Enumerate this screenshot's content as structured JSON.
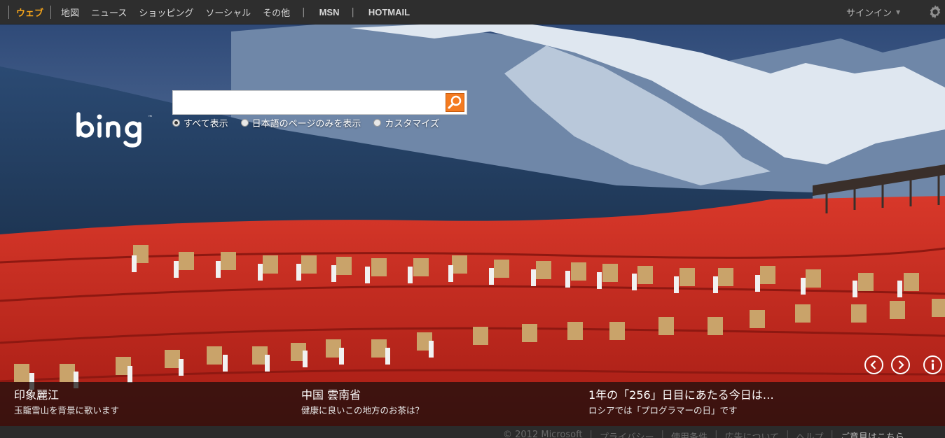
{
  "nav": {
    "web": "ウェブ",
    "maps": "地図",
    "news": "ニュース",
    "shopping": "ショッピング",
    "social": "ソーシャル",
    "more": "その他",
    "separator": "|",
    "msn": "MSN",
    "hotmail": "HOTMAIL"
  },
  "header": {
    "signin": "サインイン",
    "signin_caret": "▼",
    "settings_icon": "gear-icon"
  },
  "search": {
    "value": "",
    "placeholder": "",
    "button_icon": "magnifier-icon"
  },
  "filters": [
    {
      "label": "すべて表示",
      "selected": true
    },
    {
      "label": "日本語のページのみを表示",
      "selected": false
    },
    {
      "label": "カスタマイズ",
      "selected": false
    }
  ],
  "hero_controls": {
    "prev_icon": "chevron-left-icon",
    "next_icon": "chevron-right-icon",
    "info_icon": "info-icon"
  },
  "captions": [
    {
      "title": "印象麗江",
      "subtitle": "玉龍雪山を背景に歌います"
    },
    {
      "title": "中国 雲南省",
      "subtitle": "健康に良いこの地方のお茶は？"
    },
    {
      "title": "1年の「256」日目にあたる今日は…",
      "subtitle": "ロシアでは「プログラマーの日」です"
    }
  ],
  "footer": {
    "copyright": "© 2012 Microsoft",
    "privacy": "プライバシー",
    "terms": "使用条件",
    "advertise": "広告について",
    "help": "ヘルプ",
    "feedback": "ご意見はこちら",
    "separator": "|"
  },
  "colors": {
    "accent": "#f6a51a",
    "search_button": "#f47b20",
    "topbar": "#2e2e2e",
    "stage_red": "#c8281f"
  }
}
